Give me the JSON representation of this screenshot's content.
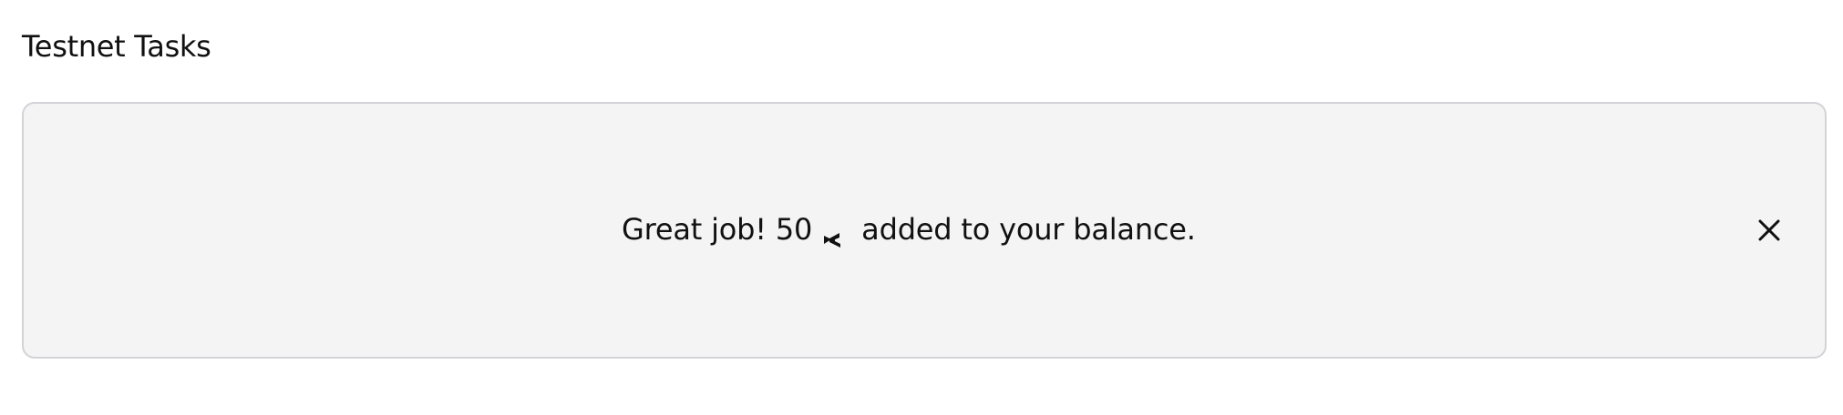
{
  "page": {
    "title": "Testnet Tasks"
  },
  "notice": {
    "prefix": "Great job! 50",
    "token_icon": "token-icon",
    "suffix": "added to your balance.",
    "close_icon": "close-icon"
  },
  "colors": {
    "text": "#111111",
    "panel_bg": "#f4f4f4",
    "panel_border": "#d3d3d8"
  }
}
